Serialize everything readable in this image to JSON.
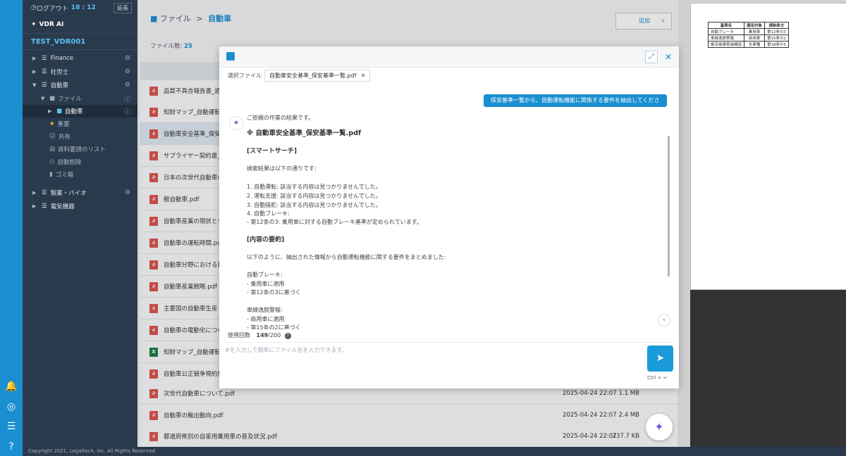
{
  "leftbar": {
    "icons": [
      "bell-icon",
      "user-icon",
      "document-icon",
      "help-icon"
    ]
  },
  "sidebar": {
    "logout_label": "ログアウト",
    "time": "18 : 12",
    "extend_label": "延長",
    "vdr_ai": "VDR AI",
    "project": "TEST_VDR001",
    "items": [
      {
        "label": "Finance"
      },
      {
        "label": "社労士"
      },
      {
        "label": "自動車"
      },
      {
        "label": "ファイル"
      },
      {
        "label": "自動車"
      },
      {
        "label": "重要"
      },
      {
        "label": "共有"
      },
      {
        "label": "資料要請のリスト"
      },
      {
        "label": "自動削除"
      },
      {
        "label": "ゴミ箱"
      },
      {
        "label": "製薬・バイオ"
      },
      {
        "label": "電気機器"
      }
    ]
  },
  "main": {
    "breadcrumb_root": "ファイル",
    "breadcrumb_sep": ">",
    "breadcrumb_current": "自動車",
    "file_count_label": "ファイル数:",
    "file_count": "25",
    "add_label": "追加",
    "files": [
      {
        "name": "品質不具合報告書_過去",
        "type": "pdf",
        "date": "",
        "size": ""
      },
      {
        "name": "知財マップ_自動運転",
        "type": "pdf",
        "date": "",
        "size": ""
      },
      {
        "name": "自動車安全基準_保安基",
        "type": "pdf",
        "date": "",
        "size": ""
      },
      {
        "name": "サプライヤー契約書_",
        "type": "pdf",
        "date": "",
        "size": ""
      },
      {
        "name": "日本の次世代自動車の",
        "type": "pdf",
        "date": "",
        "size": ""
      },
      {
        "name": "軽自動車.pdf",
        "type": "pdf",
        "date": "",
        "size": ""
      },
      {
        "name": "自動車産業の現状と今",
        "type": "pdf",
        "date": "",
        "size": ""
      },
      {
        "name": "自動車の運転時間.pdf",
        "type": "pdf",
        "date": "",
        "size": ""
      },
      {
        "name": "自動車分野における技",
        "type": "pdf",
        "date": "",
        "size": ""
      },
      {
        "name": "自動車産業戦略.pdf",
        "type": "pdf",
        "date": "",
        "size": ""
      },
      {
        "name": "主要国の自動車生産・",
        "type": "pdf",
        "date": "",
        "size": ""
      },
      {
        "name": "自動車の電動化につい",
        "type": "pdf",
        "date": "",
        "size": ""
      },
      {
        "name": "知財マップ_自動運転",
        "type": "xls",
        "date": "",
        "size": ""
      },
      {
        "name": "自動車公正競争規約集",
        "type": "pdf",
        "date": "",
        "size": ""
      },
      {
        "name": "次世代自動車について.pdf",
        "type": "pdf",
        "date": "2025-04-24 22:07",
        "size": "1.1 MB"
      },
      {
        "name": "自動車の輸出動向.pdf",
        "type": "pdf",
        "date": "2025-04-24 22:07",
        "size": "2.4 MB"
      },
      {
        "name": "都道府県別の自家用乗用車の普及状況.pdf",
        "type": "pdf",
        "date": "2025-04-24 22:07",
        "size": "237.7 KB"
      }
    ]
  },
  "footer": "Copyright 2021, Legaltech, Inc. All Rights Reserved.",
  "preview_table": {
    "headers": [
      "基準名",
      "適用対象",
      "規制条文"
    ],
    "rows": [
      [
        "自動ブレーキ",
        "乗用車",
        "第12条の3"
      ],
      [
        "車線逸脱警報",
        "商用車",
        "第15条の2"
      ],
      [
        "衝突被害軽減構造",
        "全車種",
        "第18条の5"
      ]
    ]
  },
  "chat": {
    "selected_file_label": "選択ファイル",
    "selected_file": "自動車安全基準_保安基準一覧.pdf",
    "user_message": "保安基準一覧から、自動運転機能に関係する要件を抽出してください。",
    "answer_lines": [
      "ご依頼の作業の結果です。",
      "※ 自動車安全基準_保安基準一覧.pdf",
      "[スマートサーチ]",
      "検索結果は以下の通りです:",
      "1. 自動運転: 該当する内容は見つかりませんでした。",
      "2. 運転支援: 該当する内容は見つかりませんでした。",
      "3. 自動操舵: 該当する内容は見つかりませんでした。",
      "4. 自動ブレーキ:",
      "- 第12条の3: 乗用車に対する自動ブレーキ基準が定められています。",
      "[内容の要約]",
      "以下のように、抽出された情報から自動運転機能に関する要件をまとめました:",
      "自動ブレーキ:",
      "- 乗用車に適用",
      "- 第12条の3に基づく",
      "車線逸脱警報:",
      "- 商用車に適用",
      "- 第15条の2に基づく"
    ],
    "usage_label": "使用回数",
    "usage_used": "149",
    "usage_total": "/200",
    "input_placeholder": "#を入力して簡単にファイル名を入力できます。",
    "shortcut": "Ctrl + ↵"
  }
}
